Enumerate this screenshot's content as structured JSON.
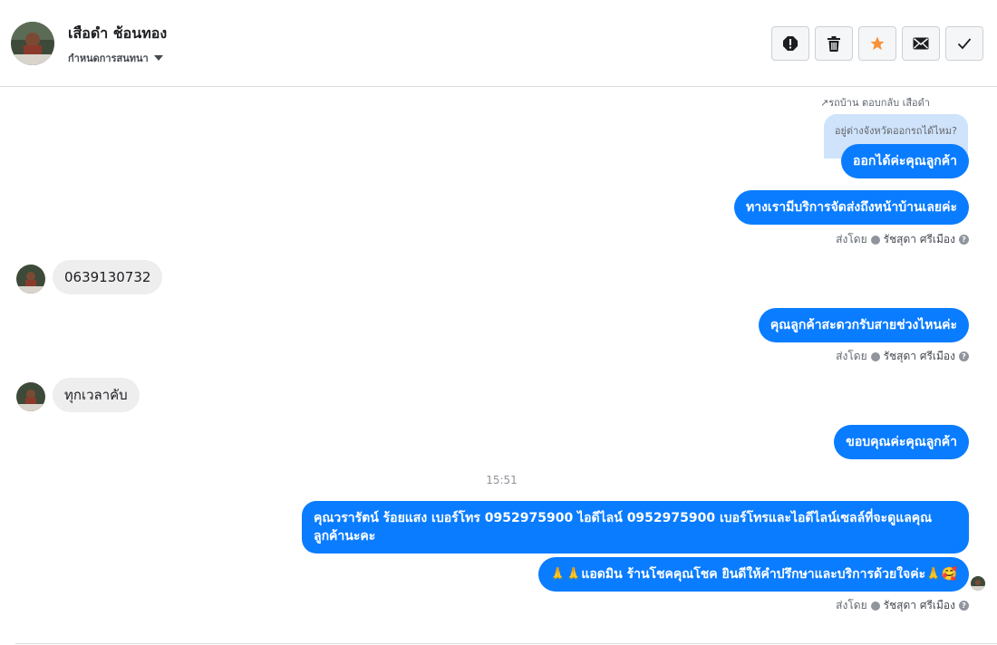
{
  "header": {
    "contact_name": "เสือดำ ช้อนทอง",
    "assign_label": "กำหนดการสนทนา",
    "actions": [
      {
        "name": "report-spam-button",
        "icon": "alert-icon"
      },
      {
        "name": "delete-button",
        "icon": "trash-icon"
      },
      {
        "name": "star-button",
        "icon": "star-icon"
      },
      {
        "name": "mark-unread-button",
        "icon": "envelope-icon"
      },
      {
        "name": "mark-done-button",
        "icon": "check-icon"
      }
    ]
  },
  "conversation": {
    "reply_meta": "↗รถบ้าน ตอบกลับ เสือดำ",
    "quoted_text": "อยู่ต่างจังหวัดออกรถได้ไหม?",
    "messages": {
      "out1": "ออกได้ค่ะคุณลูกค้า",
      "out2": "ทางเรามีบริการจัดส่งถึงหน้าบ้านเลยค่ะ",
      "in1": "0639130732",
      "out3": "คุณลูกค้าสะดวกรับสายช่วงไหนค่ะ",
      "in2": "ทุกเวลาคับ",
      "out4": "ขอบคุณค่ะคุณลูกค้า",
      "out5": "คุณวรารัตน์ ร้อยแสง        เบอร์โทร 0952975900  ไอดีไลน์ 0952975900  เบอร์โทรและไอดีไลน์เซลล์ที่จะดูแลคุณลูกค้านะคะ",
      "out6": "🙏🙏แอดมิน ร้านโชคคุณโชค ยินดีให้คำปรึกษาและบริการด้วยใจค่ะ🙏🥰"
    },
    "sent_by": {
      "prefix": "ส่งโดย",
      "name": "รัชสุดา ศรีเมือง",
      "help": "?"
    },
    "timestamp": "15:51"
  },
  "colors": {
    "outgoing_bubble": "#0a7cff",
    "incoming_bubble": "#eeeeee",
    "star_accent": "#f7923a"
  }
}
